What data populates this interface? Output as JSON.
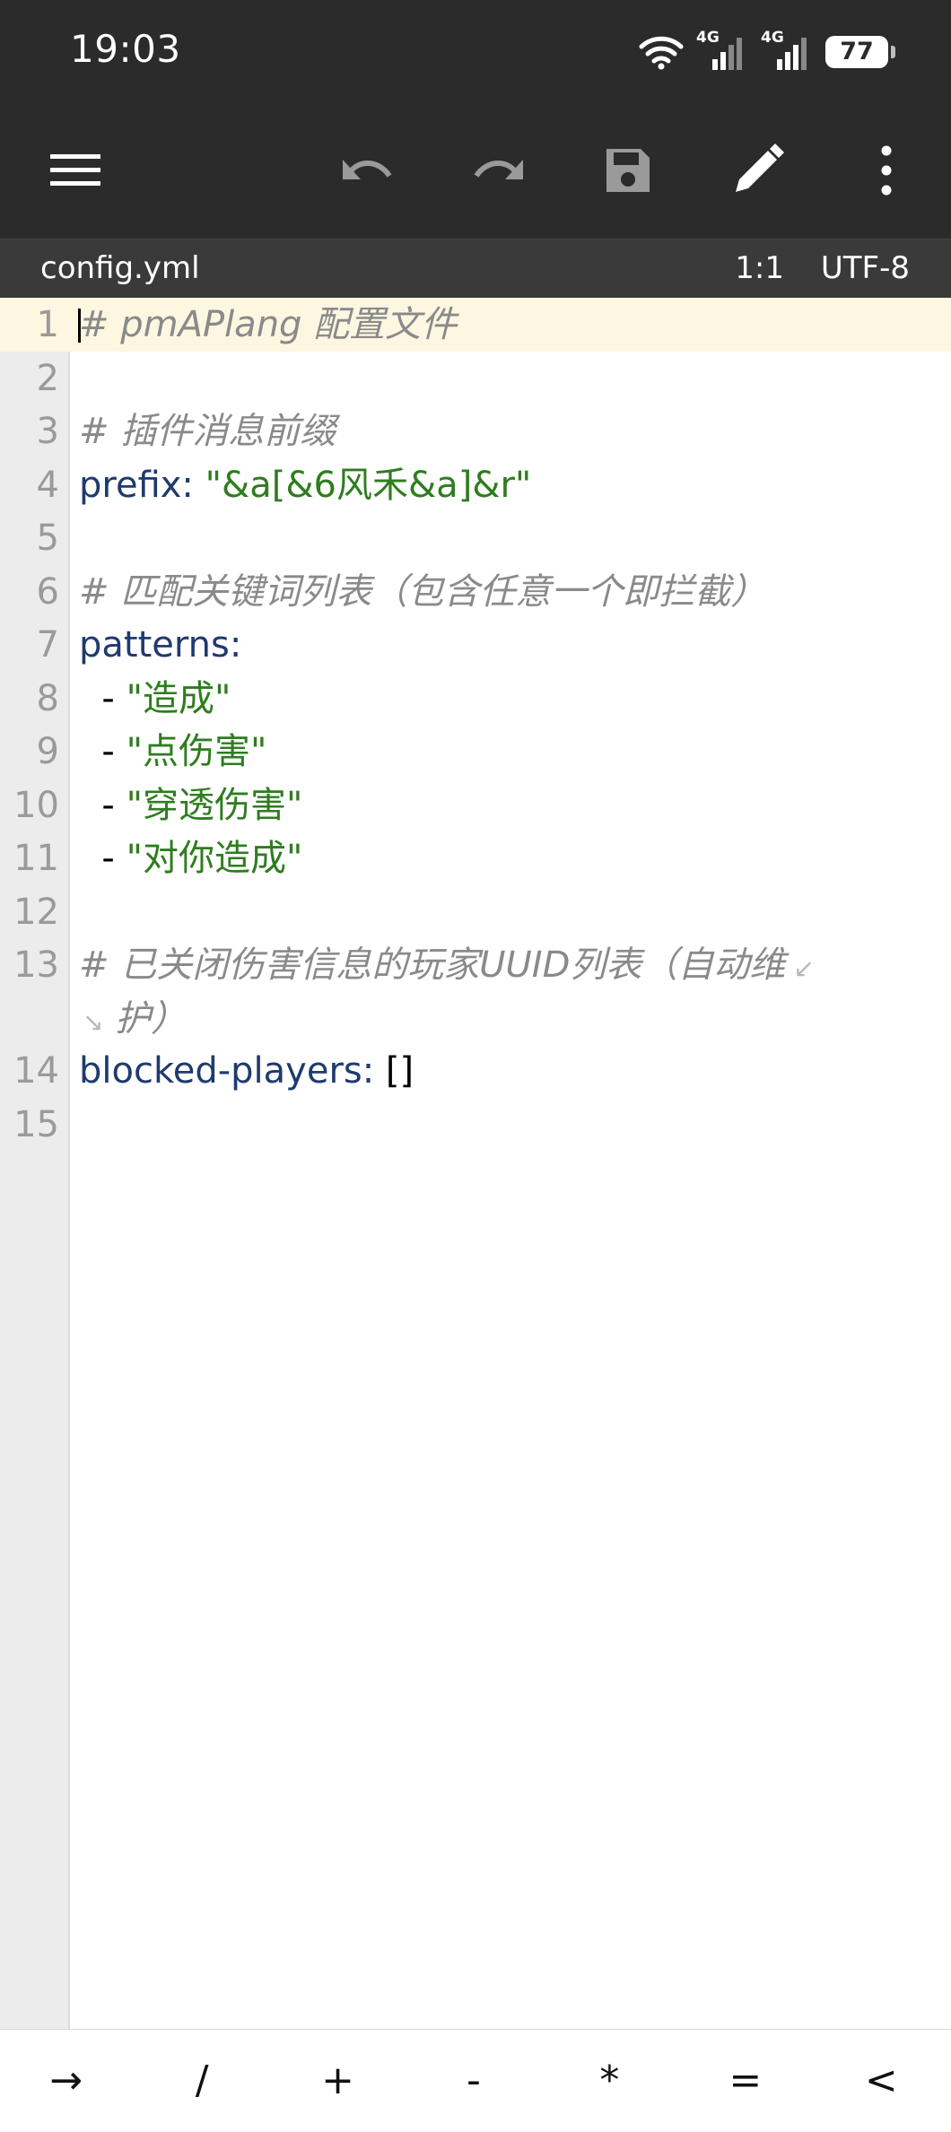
{
  "status_bar": {
    "time": "19:03",
    "network1": "4G",
    "network2": "4G",
    "battery": "77"
  },
  "toolbar": {
    "icons": [
      "menu-icon",
      "undo-icon",
      "redo-icon",
      "save-icon",
      "edit-icon",
      "more-vert-icon"
    ]
  },
  "file_bar": {
    "filename": "config.yml",
    "cursor_position": "1:1",
    "encoding": "UTF-8"
  },
  "editor": {
    "lines": [
      {
        "num": "1",
        "segments": [
          {
            "cls": "comment",
            "text": "# pmAPlang 配置文件"
          }
        ]
      },
      {
        "num": "2",
        "segments": []
      },
      {
        "num": "3",
        "segments": [
          {
            "cls": "comment",
            "text": "# 插件消息前缀"
          }
        ]
      },
      {
        "num": "4",
        "segments": [
          {
            "cls": "key",
            "text": "prefix:"
          },
          {
            "cls": "plain",
            "text": " "
          },
          {
            "cls": "str",
            "text": "\"&a[&6风禾&a]&r\""
          }
        ]
      },
      {
        "num": "5",
        "segments": []
      },
      {
        "num": "6",
        "segments": [
          {
            "cls": "comment",
            "text": "# 匹配关键词列表（包含任意一个即拦截）"
          }
        ]
      },
      {
        "num": "7",
        "segments": [
          {
            "cls": "key",
            "text": "patterns:"
          }
        ]
      },
      {
        "num": "8",
        "segments": [
          {
            "cls": "plain",
            "text": "  - "
          },
          {
            "cls": "str",
            "text": "\"造成\""
          }
        ]
      },
      {
        "num": "9",
        "segments": [
          {
            "cls": "plain",
            "text": "  - "
          },
          {
            "cls": "str",
            "text": "\"点伤害\""
          }
        ]
      },
      {
        "num": "10",
        "segments": [
          {
            "cls": "plain",
            "text": "  - "
          },
          {
            "cls": "str",
            "text": "\"穿透伤害\""
          }
        ]
      },
      {
        "num": "11",
        "segments": [
          {
            "cls": "plain",
            "text": "  - "
          },
          {
            "cls": "str",
            "text": "\"对你造成\""
          }
        ]
      },
      {
        "num": "12",
        "segments": []
      },
      {
        "num": "13",
        "segments": [
          {
            "cls": "comment",
            "text": "# 已关闭伤害信息的玩家UUID列表（自动维"
          }
        ],
        "wrap": " 护）"
      },
      {
        "num": "14",
        "segments": [
          {
            "cls": "key",
            "text": "blocked-players:"
          },
          {
            "cls": "plain",
            "text": " []"
          }
        ]
      },
      {
        "num": "15",
        "segments": []
      }
    ]
  },
  "symbol_bar": {
    "keys": [
      "→",
      "/",
      "+",
      "-",
      "*",
      "=",
      "<"
    ]
  }
}
